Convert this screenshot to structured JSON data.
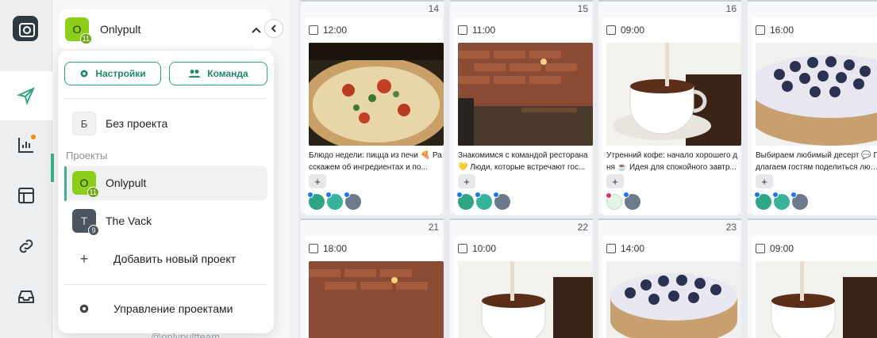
{
  "rail": {
    "items": [
      {
        "name": "publish-icon"
      },
      {
        "name": "analytics-icon"
      },
      {
        "name": "layout-icon"
      },
      {
        "name": "link-icon"
      },
      {
        "name": "inbox-icon"
      }
    ]
  },
  "project_header": {
    "avatar_letter": "O",
    "avatar_count": "11",
    "name": "Onlypult"
  },
  "popup": {
    "settings_label": "Настройки",
    "team_label": "Команда",
    "no_project": {
      "letter": "Б",
      "label": "Без проекта"
    },
    "projects_title": "Проекты",
    "projects": [
      {
        "letter": "O",
        "count": "11",
        "name": "Onlypult",
        "selected": true
      },
      {
        "letter": "T",
        "count": "9",
        "name": "The Vack",
        "selected": false
      }
    ],
    "add_project_label": "Добавить новый проект",
    "manage_label": "Управление проектами"
  },
  "background_handle": "@onlypultteam",
  "calendar": {
    "row1": [
      {
        "day": "14",
        "time": "12:00",
        "image": "pizza",
        "caption1": "Блюдо недели: пицца из печи 🍕 Ра",
        "caption2": "сскажем об ингредиентах и по...",
        "accounts": [
          "instagram",
          "instagram",
          "fox"
        ]
      },
      {
        "day": "15",
        "time": "11:00",
        "image": "restaurant",
        "caption1": "Знакомимся с командой ресторана",
        "caption2": "💛 Люди, которые встречают гос...",
        "accounts": [
          "instagram",
          "instagram",
          "fox"
        ]
      },
      {
        "day": "16",
        "time": "09:00",
        "image": "coffee",
        "caption1": "Утренний кофе: начало хорошего д",
        "caption2": "ня ☕ Идея для спокойного завтр...",
        "accounts": [
          "instagram",
          "fox"
        ]
      },
      {
        "day": "",
        "time": "16:00",
        "image": "cake",
        "caption1": "Выбираем любимый десерт 💬 П",
        "caption2": "длагаем гостям поделиться любим",
        "accounts": [
          "instagram",
          "instagram",
          "fox"
        ]
      }
    ],
    "row2": [
      {
        "day": "21",
        "time": "18:00",
        "image": "restaurant"
      },
      {
        "day": "22",
        "time": "10:00",
        "image": "coffee"
      },
      {
        "day": "23",
        "time": "14:00",
        "image": "cake"
      },
      {
        "day": "",
        "time": "09:00",
        "image": "coffee"
      }
    ]
  },
  "colors": {
    "accent": "#2ea584",
    "brand_green": "#8ccf1a",
    "notify": "#ff8a00"
  }
}
